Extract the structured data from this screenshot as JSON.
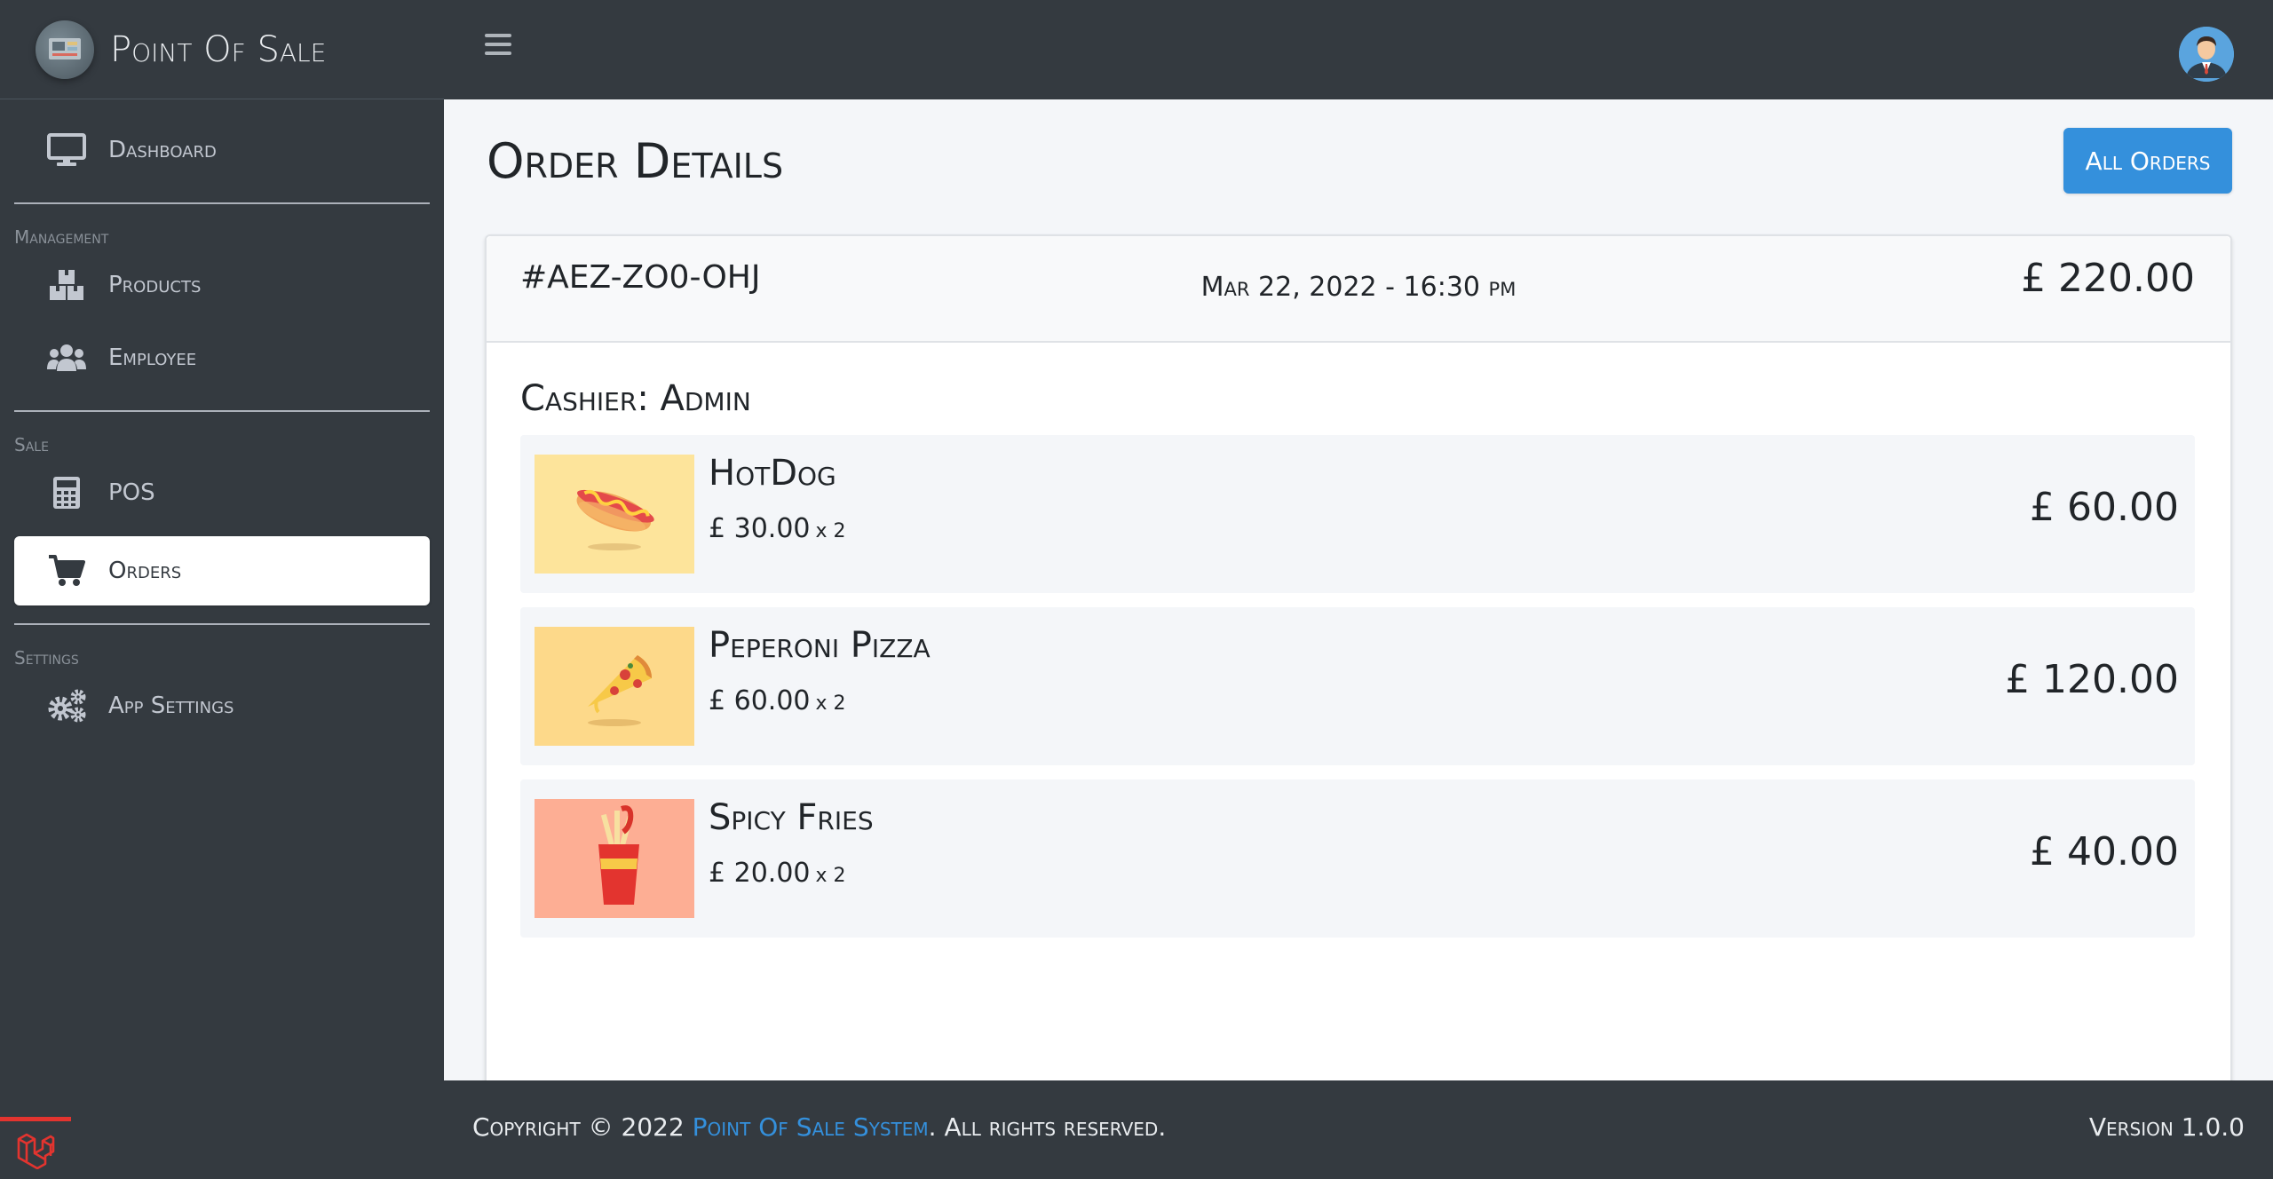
{
  "brand": {
    "name": "Point Of Sale",
    "logo_icon": "pos-logo-icon"
  },
  "sidebar": {
    "items": [
      {
        "label": "Dashboard",
        "icon": "monitor-icon"
      },
      {
        "label": "Products",
        "icon": "boxes-icon"
      },
      {
        "label": "Employee",
        "icon": "users-icon"
      },
      {
        "label": "POS",
        "icon": "calculator-icon"
      },
      {
        "label": "Orders",
        "icon": "cart-icon",
        "active": true
      },
      {
        "label": "App Settings",
        "icon": "gears-icon"
      }
    ],
    "headers": {
      "management": "Management",
      "sale": "Sale",
      "settings": "Settings"
    }
  },
  "topbar": {
    "menu_icon": "hamburger-icon",
    "avatar_icon": "user-avatar"
  },
  "page": {
    "title": "Order Details",
    "all_orders_label": "All Orders"
  },
  "order": {
    "id": "#AEZ-ZO0-OHJ",
    "date": "Mar 22, 2022 - 16:30 pm",
    "total": "£ 220.00",
    "cashier_label": "Cashier: Admin",
    "items": [
      {
        "name": "HotDog",
        "unit_price": "£ 30.00",
        "qty": "x 2",
        "total": "£ 60.00",
        "bg": "#fde49b"
      },
      {
        "name": "Peperoni Pizza",
        "unit_price": "£ 60.00",
        "qty": "x 2",
        "total": "£ 120.00",
        "bg": "#fdd98a"
      },
      {
        "name": "Spicy Fries",
        "unit_price": "£ 20.00",
        "qty": "x 2",
        "total": "£ 40.00",
        "bg": "#fdae94"
      }
    ]
  },
  "footer": {
    "copyright_prefix": "Copyright © 2022",
    "link_text": "Point Of Sale System",
    "suffix": ". All rights reserved.",
    "version": "Version 1.0.0"
  },
  "colors": {
    "sidebar_bg": "#343a40",
    "accent": "#3490dc",
    "page_bg": "#f4f6f9"
  }
}
